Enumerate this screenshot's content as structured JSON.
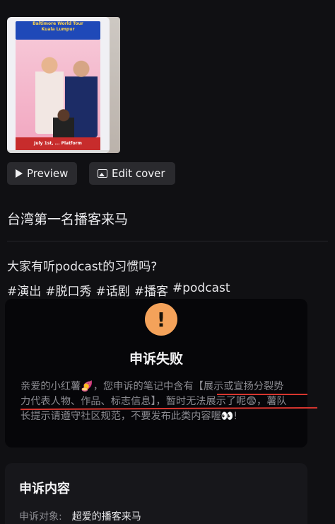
{
  "cover": {
    "poster_text_top": "Baltimore World Tour",
    "poster_text_city": "Kuala Lumpur",
    "poster_text_bottom": "July 1st, ... Platform"
  },
  "buttons": {
    "preview": "Preview",
    "edit_cover": "Edit cover"
  },
  "post": {
    "title": "台湾第一名播客来马",
    "body": "大家有听podcast的习惯吗?",
    "tags": [
      "#演出",
      "#脱口秀",
      "#话剧",
      "#播客",
      "#podcast"
    ]
  },
  "dialog": {
    "icon": "!",
    "title": "申诉失败",
    "message": "亲爱的小红薯🍠，您申诉的笔记中含有【展示或宣扬分裂势力代表人物、作品、标志信息】，暂时无法展示了呢😨，薯队长提示请遵守社区规范，不要发布此类内容喔👀!"
  },
  "appeal": {
    "title": "申诉内容",
    "object_label": "申诉对象:",
    "object_value": "超爱的播客来马"
  },
  "colors": {
    "background": "#101013",
    "warning": "#f4a25a",
    "underline": "#d7362f"
  }
}
